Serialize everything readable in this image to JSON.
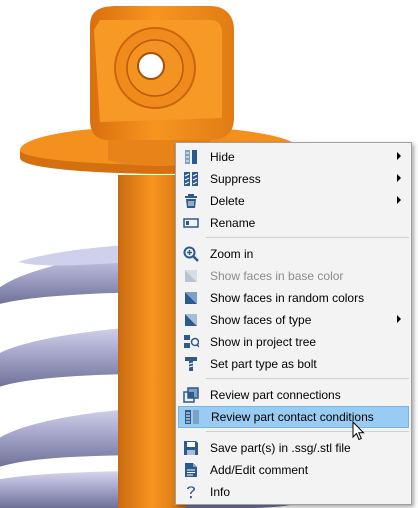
{
  "menu": {
    "items": [
      {
        "label": "Hide",
        "icon": "hide-icon",
        "submenu": true,
        "enabled": true
      },
      {
        "label": "Suppress",
        "icon": "suppress-icon",
        "submenu": true,
        "enabled": true
      },
      {
        "label": "Delete",
        "icon": "delete-icon",
        "submenu": true,
        "enabled": true
      },
      {
        "label": "Rename",
        "icon": "rename-icon",
        "submenu": false,
        "enabled": true
      },
      {
        "label": "Zoom in",
        "icon": "zoom-in-icon",
        "submenu": false,
        "enabled": true
      },
      {
        "label": "Show faces in base color",
        "icon": "faces-base-color-icon",
        "submenu": false,
        "enabled": false
      },
      {
        "label": "Show faces in random colors",
        "icon": "faces-random-colors-icon",
        "submenu": false,
        "enabled": true
      },
      {
        "label": "Show faces of type",
        "icon": "faces-of-type-icon",
        "submenu": true,
        "enabled": true
      },
      {
        "label": "Show in project tree",
        "icon": "project-tree-icon",
        "submenu": false,
        "enabled": true
      },
      {
        "label": "Set part type as bolt",
        "icon": "bolt-icon",
        "submenu": false,
        "enabled": true
      },
      {
        "label": "Review part connections",
        "icon": "part-connections-icon",
        "submenu": false,
        "enabled": true
      },
      {
        "label": "Review part contact conditions",
        "icon": "contact-conditions-icon",
        "submenu": false,
        "enabled": true,
        "highlighted": true
      },
      {
        "label": "Save part(s) in .ssg/.stl file",
        "icon": "save-icon",
        "submenu": false,
        "enabled": true
      },
      {
        "label": "Add/Edit comment",
        "icon": "comment-icon",
        "submenu": false,
        "enabled": true
      },
      {
        "label": "Info",
        "icon": "info-icon",
        "submenu": false,
        "enabled": true
      }
    ]
  },
  "colors": {
    "part_orange": "#f28a1e",
    "spring_lavender": "#a3a4c8",
    "menu_background": "#f3f3f3",
    "highlight": "#99ccf2",
    "icon_blue": "#2c5a8e"
  }
}
